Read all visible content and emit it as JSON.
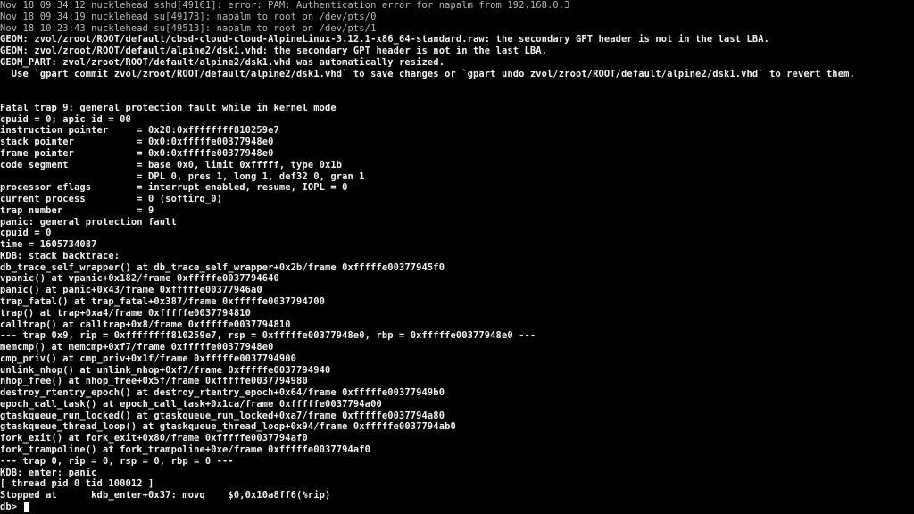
{
  "console": {
    "colors": {
      "background": "#000000",
      "normal_text": "#b8b8b8",
      "bright_text": "#f2f2f2",
      "cursor": "#ffffff"
    },
    "lines": [
      {
        "text": "Nov 18 09:34:12 nucklehead sshd[49161]: error: PAM: Authentication error for napalm from 192.168.0.3",
        "style": "dim"
      },
      {
        "text": "Nov 18 09:34:19 nucklehead su[49173]: napalm to root on /dev/pts/0",
        "style": "dim"
      },
      {
        "text": "Nov 18 10:23:43 nucklehead su[49513]: napalm to root on /dev/pts/1",
        "style": "dim"
      },
      {
        "text": "GEOM: zvol/zroot/ROOT/default/cbsd-cloud-cloud-AlpineLinux-3.12.1-x86_64-standard.raw: the secondary GPT header is not in the last LBA.",
        "style": "bright"
      },
      {
        "text": "GEOM: zvol/zroot/ROOT/default/alpine2/dsk1.vhd: the secondary GPT header is not in the last LBA.",
        "style": "bright"
      },
      {
        "text": "GEOM_PART: zvol/zroot/ROOT/default/alpine2/dsk1.vhd was automatically resized.",
        "style": "bright"
      },
      {
        "text": "  Use `gpart commit zvol/zroot/ROOT/default/alpine2/dsk1.vhd` to save changes or `gpart undo zvol/zroot/ROOT/default/alpine2/dsk1.vhd` to revert them.",
        "style": "bright"
      },
      {
        "text": "",
        "style": "bright"
      },
      {
        "text": "",
        "style": "bright"
      },
      {
        "text": "Fatal trap 9: general protection fault while in kernel mode",
        "style": "bright"
      },
      {
        "text": "cpuid = 0; apic id = 00",
        "style": "bright"
      },
      {
        "text": "instruction pointer     = 0x20:0xffffffff810259e7",
        "style": "bright"
      },
      {
        "text": "stack pointer           = 0x0:0xfffffe00377948e0",
        "style": "bright"
      },
      {
        "text": "frame pointer           = 0x0:0xfffffe00377948e0",
        "style": "bright"
      },
      {
        "text": "code segment            = base 0x0, limit 0xfffff, type 0x1b",
        "style": "bright"
      },
      {
        "text": "                        = DPL 0, pres 1, long 1, def32 0, gran 1",
        "style": "bright"
      },
      {
        "text": "processor eflags        = interrupt enabled, resume, IOPL = 0",
        "style": "bright"
      },
      {
        "text": "current process         = 0 (softirq_0)",
        "style": "bright"
      },
      {
        "text": "trap number             = 9",
        "style": "bright"
      },
      {
        "text": "panic: general protection fault",
        "style": "bright"
      },
      {
        "text": "cpuid = 0",
        "style": "bright"
      },
      {
        "text": "time = 1605734087",
        "style": "bright"
      },
      {
        "text": "KDB: stack backtrace:",
        "style": "bright"
      },
      {
        "text": "db_trace_self_wrapper() at db_trace_self_wrapper+0x2b/frame 0xfffffe00377945f0",
        "style": "bright"
      },
      {
        "text": "vpanic() at vpanic+0x182/frame 0xfffffe0037794640",
        "style": "bright"
      },
      {
        "text": "panic() at panic+0x43/frame 0xfffffe00377946a0",
        "style": "bright"
      },
      {
        "text": "trap_fatal() at trap_fatal+0x387/frame 0xfffffe0037794700",
        "style": "bright"
      },
      {
        "text": "trap() at trap+0xa4/frame 0xfffffe0037794810",
        "style": "bright"
      },
      {
        "text": "calltrap() at calltrap+0x8/frame 0xfffffe0037794810",
        "style": "bright"
      },
      {
        "text": "--- trap 0x9, rip = 0xffffffff810259e7, rsp = 0xfffffe00377948e0, rbp = 0xfffffe00377948e0 ---",
        "style": "bright"
      },
      {
        "text": "memcmp() at memcmp+0xf7/frame 0xfffffe00377948e0",
        "style": "bright"
      },
      {
        "text": "cmp_priv() at cmp_priv+0x1f/frame 0xfffffe0037794900",
        "style": "bright"
      },
      {
        "text": "unlink_nhop() at unlink_nhop+0xf7/frame 0xfffffe0037794940",
        "style": "bright"
      },
      {
        "text": "nhop_free() at nhop_free+0x5f/frame 0xfffffe0037794980",
        "style": "bright"
      },
      {
        "text": "destroy_rtentry_epoch() at destroy_rtentry_epoch+0x64/frame 0xfffffe00377949b0",
        "style": "bright"
      },
      {
        "text": "epoch_call_task() at epoch_call_task+0x1ca/frame 0xfffffe0037794a00",
        "style": "bright"
      },
      {
        "text": "gtaskqueue_run_locked() at gtaskqueue_run_locked+0xa7/frame 0xfffffe0037794a80",
        "style": "bright"
      },
      {
        "text": "gtaskqueue_thread_loop() at gtaskqueue_thread_loop+0x94/frame 0xfffffe0037794ab0",
        "style": "bright"
      },
      {
        "text": "fork_exit() at fork_exit+0x80/frame 0xfffffe0037794af0",
        "style": "bright"
      },
      {
        "text": "fork_trampoline() at fork_trampoline+0xe/frame 0xfffffe0037794af0",
        "style": "bright"
      },
      {
        "text": "--- trap 0, rip = 0, rsp = 0, rbp = 0 ---",
        "style": "bright"
      },
      {
        "text": "KDB: enter: panic",
        "style": "bright"
      },
      {
        "text": "[ thread pid 0 tid 100012 ]",
        "style": "bright"
      },
      {
        "text": "Stopped at      kdb_enter+0x37: movq    $0,0x10a8ff6(%rip)",
        "style": "bright"
      }
    ],
    "prompt": {
      "text": "db> ",
      "input_value": ""
    }
  }
}
